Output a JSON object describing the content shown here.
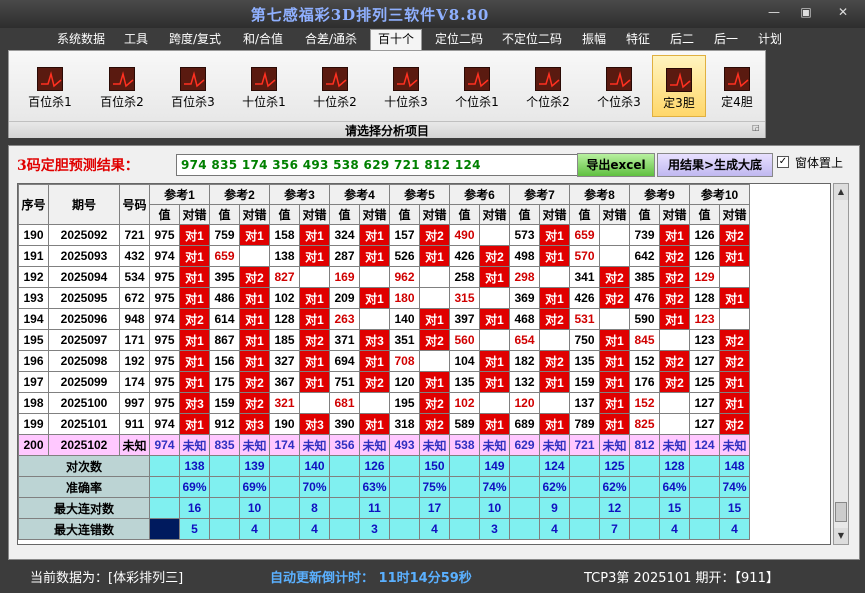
{
  "app": {
    "title": "第七感福彩3D排列三软件V8.80",
    "win_min": "—",
    "win_max": "▣",
    "win_close": "✕"
  },
  "menu": [
    "系统数据",
    "工具",
    "跨度/复式",
    "和/合值",
    "合差/通杀",
    "百十个",
    "定位二码",
    "不定位二码",
    "振幅",
    "特征",
    "后二",
    "后一",
    "计划"
  ],
  "menu_active": "百十个",
  "ribbon": {
    "buttons": [
      "百位杀1",
      "百位杀2",
      "百位杀3",
      "十位杀1",
      "十位杀2",
      "十位杀3",
      "个位杀1",
      "个位杀2",
      "个位杀3",
      "定3胆",
      "定4胆"
    ],
    "selected": "定3胆",
    "footer": "请选择分析项目"
  },
  "prediction": {
    "label": "3码定胆预测结果：",
    "value": "974  835  174  356  493  538  629  721  812  124",
    "export_btn": "导出excel",
    "generate_btn": "用结果>生成大底",
    "topmost_label": "窗体置上",
    "topmost_checked": "✓"
  },
  "table": {
    "headers": {
      "idx": "序号",
      "period": "期号",
      "num": "号码",
      "val": "值",
      "res": "对错"
    },
    "refs": [
      "参考1",
      "参考2",
      "参考3",
      "参考4",
      "参考5",
      "参考6",
      "参考7",
      "参考8",
      "参考9",
      "参考10"
    ],
    "rows": [
      {
        "idx": "190",
        "period": "2025092",
        "num": "721",
        "cells": [
          [
            "975",
            "对1"
          ],
          [
            "759",
            "对1"
          ],
          [
            "158",
            "对1"
          ],
          [
            "324",
            "对1"
          ],
          [
            "157",
            "对2"
          ],
          [
            "490",
            ""
          ],
          [
            "573",
            "对1"
          ],
          [
            "659",
            ""
          ],
          [
            "739",
            "对1"
          ],
          [
            "126",
            "对2"
          ]
        ]
      },
      {
        "idx": "191",
        "period": "2025093",
        "num": "432",
        "cells": [
          [
            "974",
            "对1"
          ],
          [
            "659",
            ""
          ],
          [
            "138",
            "对1"
          ],
          [
            "287",
            "对1"
          ],
          [
            "526",
            "对1"
          ],
          [
            "426",
            "对2"
          ],
          [
            "498",
            "对1"
          ],
          [
            "570",
            ""
          ],
          [
            "642",
            "对2"
          ],
          [
            "126",
            "对1"
          ]
        ]
      },
      {
        "idx": "192",
        "period": "2025094",
        "num": "534",
        "cells": [
          [
            "975",
            "对1"
          ],
          [
            "395",
            "对2"
          ],
          [
            "827",
            ""
          ],
          [
            "169",
            ""
          ],
          [
            "962",
            ""
          ],
          [
            "258",
            "对1"
          ],
          [
            "298",
            ""
          ],
          [
            "341",
            "对2"
          ],
          [
            "385",
            "对2"
          ],
          [
            "129",
            ""
          ]
        ]
      },
      {
        "idx": "193",
        "period": "2025095",
        "num": "672",
        "cells": [
          [
            "975",
            "对1"
          ],
          [
            "486",
            "对1"
          ],
          [
            "102",
            "对1"
          ],
          [
            "209",
            "对1"
          ],
          [
            "180",
            ""
          ],
          [
            "315",
            ""
          ],
          [
            "369",
            "对1"
          ],
          [
            "426",
            "对2"
          ],
          [
            "476",
            "对2"
          ],
          [
            "128",
            "对1"
          ]
        ]
      },
      {
        "idx": "194",
        "period": "2025096",
        "num": "948",
        "cells": [
          [
            "974",
            "对2"
          ],
          [
            "614",
            "对1"
          ],
          [
            "128",
            "对1"
          ],
          [
            "263",
            ""
          ],
          [
            "140",
            "对1"
          ],
          [
            "397",
            "对1"
          ],
          [
            "468",
            "对2"
          ],
          [
            "531",
            ""
          ],
          [
            "590",
            "对1"
          ],
          [
            "123",
            ""
          ]
        ]
      },
      {
        "idx": "195",
        "period": "2025097",
        "num": "171",
        "cells": [
          [
            "975",
            "对1"
          ],
          [
            "867",
            "对1"
          ],
          [
            "185",
            "对2"
          ],
          [
            "371",
            "对3"
          ],
          [
            "351",
            "对2"
          ],
          [
            "560",
            ""
          ],
          [
            "654",
            ""
          ],
          [
            "750",
            "对1"
          ],
          [
            "845",
            ""
          ],
          [
            "123",
            "对2"
          ]
        ]
      },
      {
        "idx": "196",
        "period": "2025098",
        "num": "192",
        "cells": [
          [
            "975",
            "对1"
          ],
          [
            "156",
            "对1"
          ],
          [
            "327",
            "对1"
          ],
          [
            "694",
            "对1"
          ],
          [
            "708",
            ""
          ],
          [
            "104",
            "对1"
          ],
          [
            "182",
            "对2"
          ],
          [
            "135",
            "对1"
          ],
          [
            "152",
            "对2"
          ],
          [
            "127",
            "对2"
          ]
        ]
      },
      {
        "idx": "197",
        "period": "2025099",
        "num": "174",
        "cells": [
          [
            "975",
            "对1"
          ],
          [
            "175",
            "对2"
          ],
          [
            "367",
            "对1"
          ],
          [
            "751",
            "对2"
          ],
          [
            "120",
            "对1"
          ],
          [
            "135",
            "对1"
          ],
          [
            "132",
            "对1"
          ],
          [
            "159",
            "对1"
          ],
          [
            "176",
            "对2"
          ],
          [
            "125",
            "对1"
          ]
        ]
      },
      {
        "idx": "198",
        "period": "2025100",
        "num": "997",
        "cells": [
          [
            "975",
            "对3"
          ],
          [
            "159",
            "对2"
          ],
          [
            "321",
            ""
          ],
          [
            "681",
            ""
          ],
          [
            "195",
            "对2"
          ],
          [
            "102",
            ""
          ],
          [
            "120",
            ""
          ],
          [
            "137",
            "对1"
          ],
          [
            "152",
            ""
          ],
          [
            "127",
            "对1"
          ]
        ]
      },
      {
        "idx": "199",
        "period": "2025101",
        "num": "911",
        "cells": [
          [
            "974",
            "对1"
          ],
          [
            "912",
            "对3"
          ],
          [
            "190",
            "对3"
          ],
          [
            "390",
            "对1"
          ],
          [
            "318",
            "对2"
          ],
          [
            "589",
            "对1"
          ],
          [
            "689",
            "对1"
          ],
          [
            "789",
            "对1"
          ],
          [
            "825",
            ""
          ],
          [
            "127",
            "对2"
          ]
        ]
      }
    ],
    "current": {
      "idx": "200",
      "period": "2025102",
      "num": "未知",
      "cells": [
        [
          "974",
          "未知"
        ],
        [
          "835",
          "未知"
        ],
        [
          "174",
          "未知"
        ],
        [
          "356",
          "未知"
        ],
        [
          "493",
          "未知"
        ],
        [
          "538",
          "未知"
        ],
        [
          "629",
          "未知"
        ],
        [
          "721",
          "未知"
        ],
        [
          "812",
          "未知"
        ],
        [
          "124",
          "未知"
        ]
      ]
    },
    "stats": [
      {
        "label": "对次数",
        "values": [
          "138",
          "139",
          "140",
          "126",
          "150",
          "149",
          "124",
          "125",
          "128",
          "148"
        ]
      },
      {
        "label": "准确率",
        "values": [
          "69%",
          "69%",
          "70%",
          "63%",
          "75%",
          "74%",
          "62%",
          "62%",
          "64%",
          "74%"
        ]
      },
      {
        "label": "最大连对数",
        "values": [
          "16",
          "10",
          "8",
          "11",
          "17",
          "10",
          "9",
          "12",
          "15",
          "15"
        ]
      },
      {
        "label": "最大连错数",
        "values": [
          "5",
          "4",
          "4",
          "3",
          "4",
          "3",
          "4",
          "7",
          "4",
          "4"
        ]
      }
    ]
  },
  "status": {
    "source": "当前数据为：[体彩排列三]",
    "countdown": "自动更新倒计时：  11时14分59秒",
    "latest": "TCP3第 2025101 期开：【911】"
  },
  "colors": {
    "hit": "#e00000",
    "stat_bg": "#80f0f0",
    "current_bg": "#ffc8ff",
    "accent": "#5ab0ff"
  }
}
